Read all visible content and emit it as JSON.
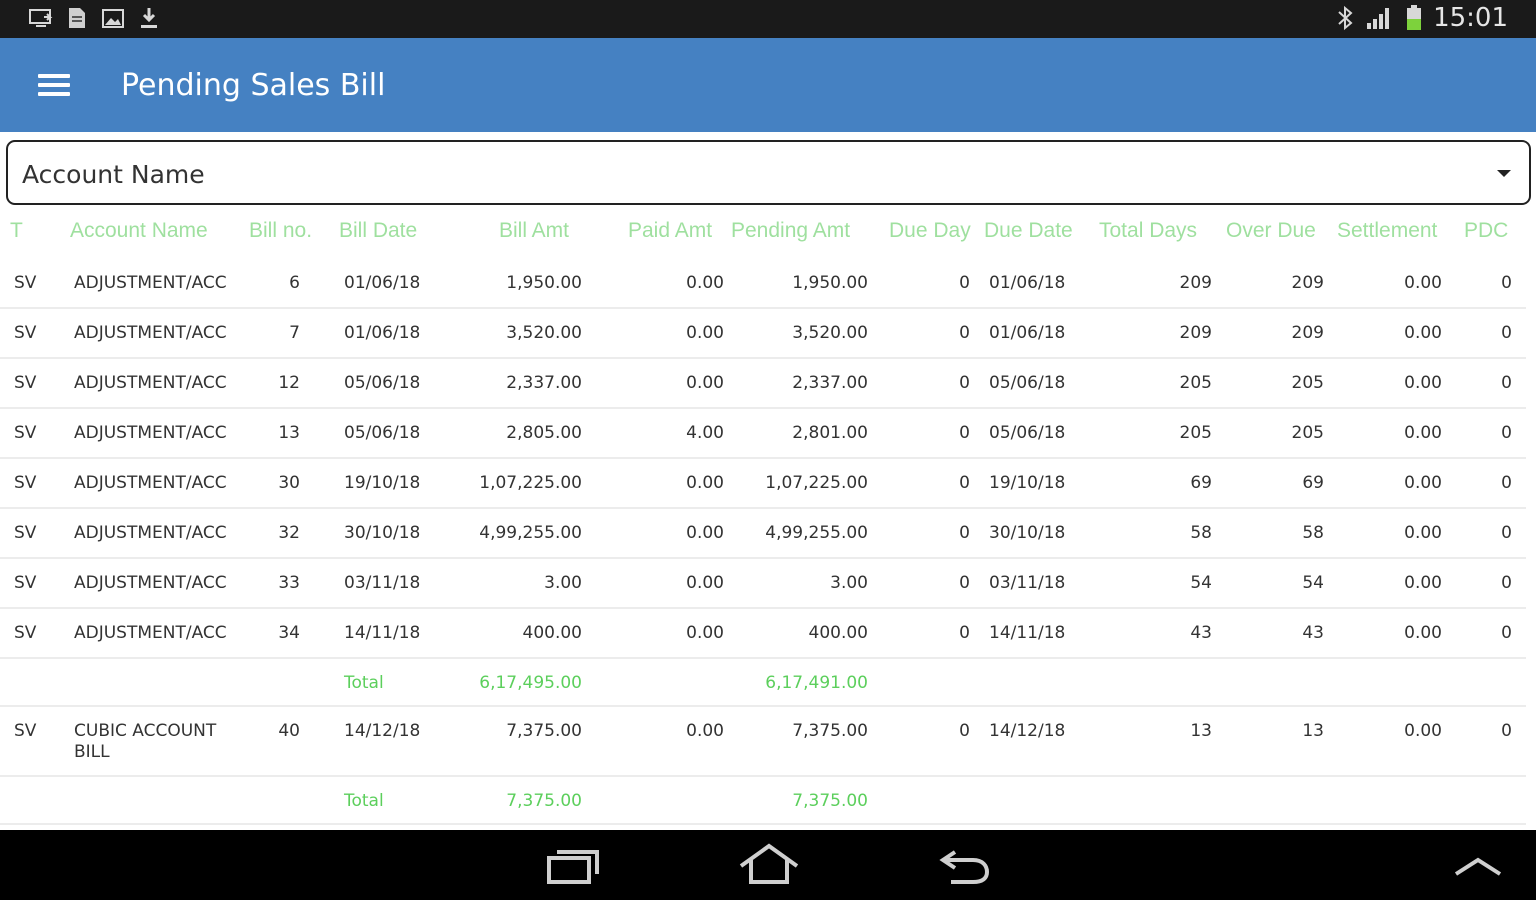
{
  "status_bar": {
    "time": "15:01",
    "left_icons": [
      "screen-mirror-icon",
      "document-icon",
      "image-icon",
      "download-icon"
    ],
    "right_icons": [
      "bluetooth-icon",
      "signal-icon",
      "battery-icon"
    ]
  },
  "app_bar": {
    "title": "Pending Sales Bill",
    "background": "#4581c2"
  },
  "account_select": {
    "label": "Account Name"
  },
  "table": {
    "headers": [
      "T",
      "Account Name",
      "Bill no.",
      "Bill Date",
      "Bill Amt",
      "Paid Amt",
      "Pending Amt",
      "Due Day",
      "Due Date",
      "Total Days",
      "Over Due",
      "Settlement",
      "PDC"
    ],
    "rows": [
      {
        "t": "SV",
        "account": "ADJUSTMENT/ACC",
        "bill_no": "6",
        "bill_date": "01/06/18",
        "bill_amt": "1,950.00",
        "paid_amt": "0.00",
        "pending_amt": "1,950.00",
        "due_day": "0",
        "due_date": "01/06/18",
        "total_days": "209",
        "over_due": "209",
        "settlement": "0.00",
        "pdc": "0"
      },
      {
        "t": "SV",
        "account": "ADJUSTMENT/ACC",
        "bill_no": "7",
        "bill_date": "01/06/18",
        "bill_amt": "3,520.00",
        "paid_amt": "0.00",
        "pending_amt": "3,520.00",
        "due_day": "0",
        "due_date": "01/06/18",
        "total_days": "209",
        "over_due": "209",
        "settlement": "0.00",
        "pdc": "0"
      },
      {
        "t": "SV",
        "account": "ADJUSTMENT/ACC",
        "bill_no": "12",
        "bill_date": "05/06/18",
        "bill_amt": "2,337.00",
        "paid_amt": "0.00",
        "pending_amt": "2,337.00",
        "due_day": "0",
        "due_date": "05/06/18",
        "total_days": "205",
        "over_due": "205",
        "settlement": "0.00",
        "pdc": "0"
      },
      {
        "t": "SV",
        "account": "ADJUSTMENT/ACC",
        "bill_no": "13",
        "bill_date": "05/06/18",
        "bill_amt": "2,805.00",
        "paid_amt": "4.00",
        "pending_amt": "2,801.00",
        "due_day": "0",
        "due_date": "05/06/18",
        "total_days": "205",
        "over_due": "205",
        "settlement": "0.00",
        "pdc": "0"
      },
      {
        "t": "SV",
        "account": "ADJUSTMENT/ACC",
        "bill_no": "30",
        "bill_date": "19/10/18",
        "bill_amt": "1,07,225.00",
        "paid_amt": "0.00",
        "pending_amt": "1,07,225.00",
        "due_day": "0",
        "due_date": "19/10/18",
        "total_days": "69",
        "over_due": "69",
        "settlement": "0.00",
        "pdc": "0"
      },
      {
        "t": "SV",
        "account": "ADJUSTMENT/ACC",
        "bill_no": "32",
        "bill_date": "30/10/18",
        "bill_amt": "4,99,255.00",
        "paid_amt": "0.00",
        "pending_amt": "4,99,255.00",
        "due_day": "0",
        "due_date": "30/10/18",
        "total_days": "58",
        "over_due": "58",
        "settlement": "0.00",
        "pdc": "0"
      },
      {
        "t": "SV",
        "account": "ADJUSTMENT/ACC",
        "bill_no": "33",
        "bill_date": "03/11/18",
        "bill_amt": "3.00",
        "paid_amt": "0.00",
        "pending_amt": "3.00",
        "due_day": "0",
        "due_date": "03/11/18",
        "total_days": "54",
        "over_due": "54",
        "settlement": "0.00",
        "pdc": "0"
      },
      {
        "t": "SV",
        "account": "ADJUSTMENT/ACC",
        "bill_no": "34",
        "bill_date": "14/11/18",
        "bill_amt": "400.00",
        "paid_amt": "0.00",
        "pending_amt": "400.00",
        "due_day": "0",
        "due_date": "14/11/18",
        "total_days": "43",
        "over_due": "43",
        "settlement": "0.00",
        "pdc": "0"
      }
    ],
    "total_1": {
      "label": "Total",
      "bill_amt": "6,17,495.00",
      "pending_amt": "6,17,491.00"
    },
    "row_2": {
      "t": "SV",
      "account_line1": "CUBIC ACCOUNT",
      "account_line2": "BILL",
      "bill_no": "40",
      "bill_date": "14/12/18",
      "bill_amt": "7,375.00",
      "paid_amt": "0.00",
      "pending_amt": "7,375.00",
      "due_day": "0",
      "due_date": "14/12/18",
      "total_days": "13",
      "over_due": "13",
      "settlement": "0.00",
      "pdc": "0"
    },
    "total_2": {
      "label": "Total",
      "bill_amt": "7,375.00",
      "pending_amt": "7,375.00"
    }
  },
  "nav_bar": {
    "buttons": [
      "recent-apps-icon",
      "home-icon",
      "back-icon",
      "chevron-up-icon"
    ]
  }
}
